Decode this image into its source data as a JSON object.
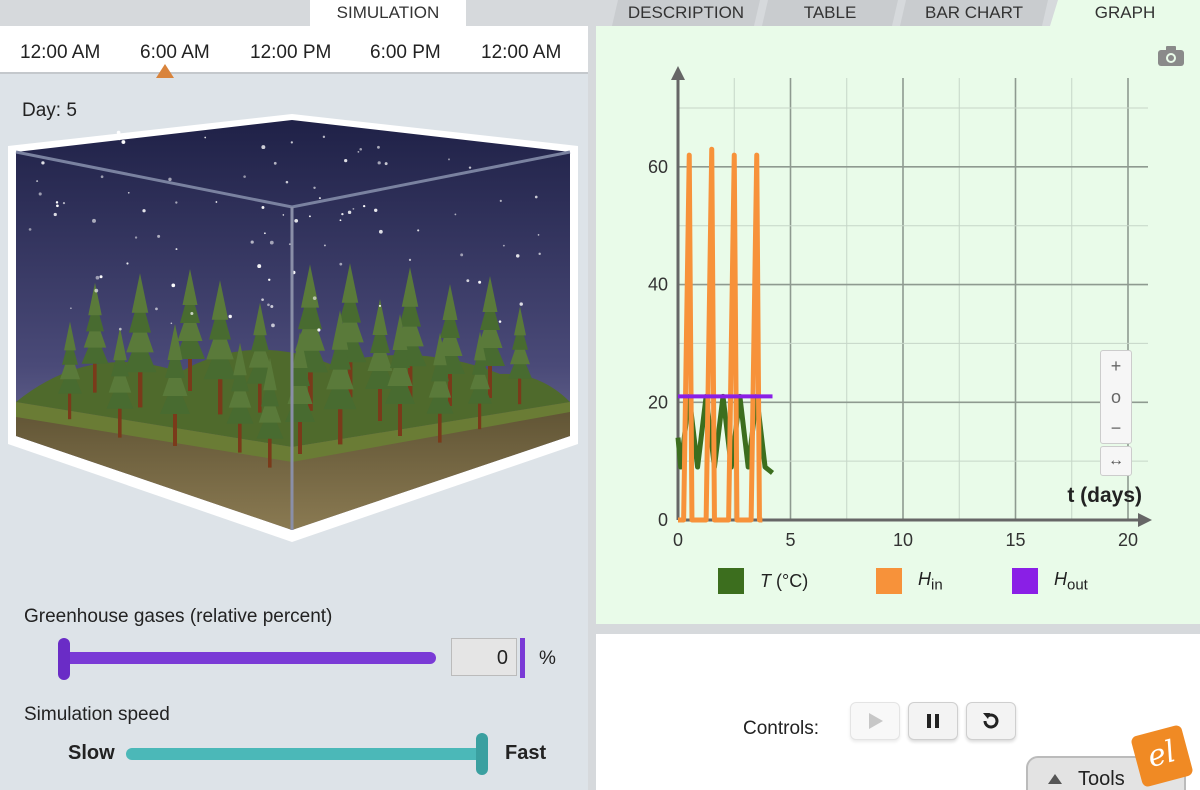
{
  "tabs": [
    {
      "label": "SIMULATION",
      "active": true
    },
    {
      "label": "DESCRIPTION",
      "active": false
    },
    {
      "label": "TABLE",
      "active": false
    },
    {
      "label": "BAR CHART",
      "active": false
    },
    {
      "label": "GRAPH",
      "active": true
    }
  ],
  "timeline": {
    "labels": [
      "12:00 AM",
      "6:00 AM",
      "12:00 PM",
      "6:00 PM",
      "12:00 AM"
    ],
    "marker_color": "#d9843c"
  },
  "day": "Day: 5",
  "greenhouse": {
    "title": "Greenhouse gases (relative percent)",
    "value": "0",
    "unit": "%",
    "slider_fraction": 0.0,
    "color": "#7a3ad6"
  },
  "speed": {
    "title": "Simulation speed",
    "slow_label": "Slow",
    "fast_label": "Fast",
    "slider_fraction": 1.0,
    "color": "#4bb8b8"
  },
  "graph": {
    "zoom_in_label": "+",
    "zoom_reset_label": "o",
    "zoom_out_label": "−",
    "pan_label": "↔",
    "legend": [
      {
        "label_main": "T",
        "label_rest": " (°C)",
        "color": "#3c6e1e"
      },
      {
        "label_main": "H",
        "label_sub": "in",
        "color": "#f7923a"
      },
      {
        "label_main": "H",
        "label_sub": "out",
        "color": "#8a1fe6"
      }
    ]
  },
  "chart_data": {
    "type": "line",
    "xlabel": "t (days)",
    "xlim": [
      0,
      20
    ],
    "ylim": [
      0,
      70
    ],
    "xticks": [
      0,
      5,
      10,
      15,
      20
    ],
    "yticks": [
      0,
      20,
      40,
      60
    ],
    "grid": true,
    "series": [
      {
        "name": "T (°C)",
        "color": "#3c6e1e",
        "x": [
          0,
          0.12,
          0.5,
          0.87,
          1.25,
          1.62,
          2.0,
          2.37,
          2.75,
          3.12,
          3.5,
          3.87,
          4.2
        ],
        "y": [
          14,
          9,
          21,
          9,
          21,
          9,
          21,
          9,
          21,
          9,
          21,
          9,
          8
        ]
      },
      {
        "name": "H in",
        "color": "#f7923a",
        "x": [
          0,
          0.12,
          0.25,
          0.5,
          0.62,
          0.75,
          1.0,
          1.12,
          1.25,
          1.5,
          1.62,
          1.75,
          2.0,
          2.12,
          2.25,
          2.5,
          2.62,
          2.75,
          3.0,
          3.12,
          3.25,
          3.5,
          3.62,
          3.75
        ],
        "y": [
          0,
          0,
          0,
          62,
          0,
          0,
          0,
          0,
          0,
          63,
          0,
          0,
          0,
          0,
          0,
          62,
          0,
          0,
          0,
          0,
          0,
          62,
          0,
          0
        ]
      },
      {
        "name": "H out",
        "color": "#8a1fe6",
        "x": [
          0,
          4.2
        ],
        "y": [
          21,
          21
        ]
      }
    ]
  },
  "controls": {
    "label": "Controls:",
    "play_icon": "play-icon",
    "pause_icon": "pause-icon",
    "reset_icon": "reset-icon"
  },
  "tools": {
    "label": "Tools"
  },
  "logo_text": "el"
}
